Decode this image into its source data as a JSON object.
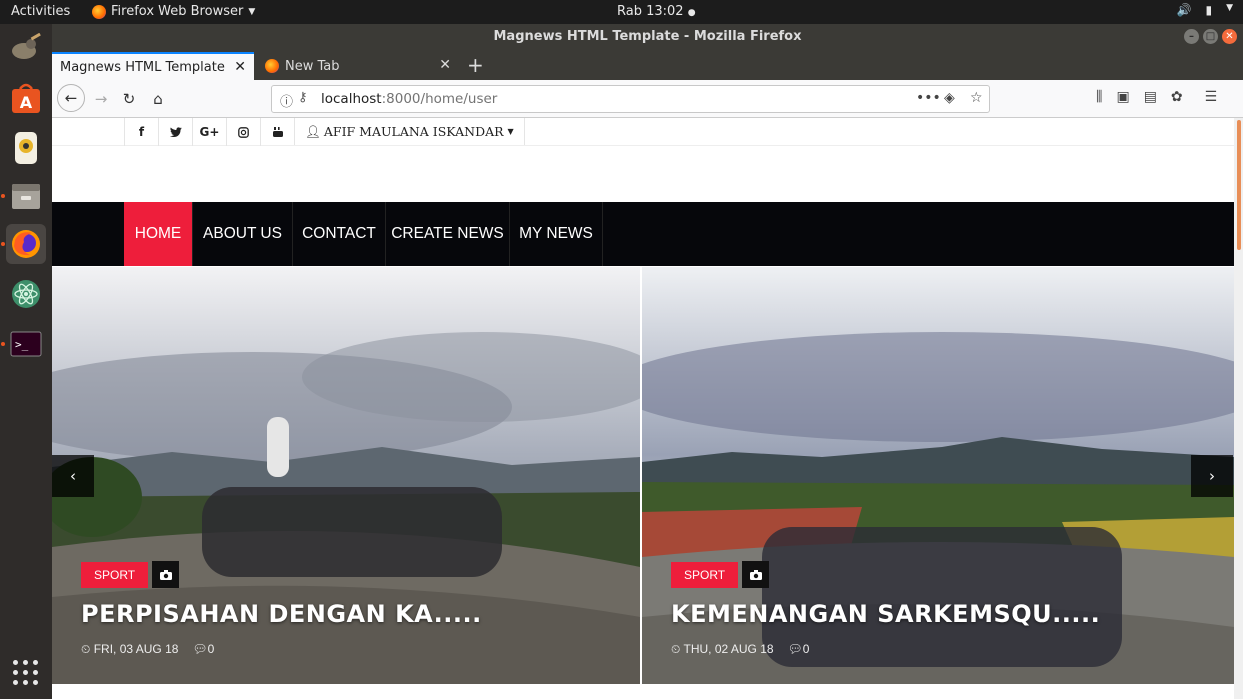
{
  "desktop": {
    "activities": "Activities",
    "app_menu": "Firefox Web Browser",
    "clock": "Rab 13:02"
  },
  "window": {
    "title": "Magnews HTML Template - Mozilla Firefox"
  },
  "tabs": [
    {
      "label": "Magnews HTML Template"
    },
    {
      "label": "New Tab"
    }
  ],
  "url": {
    "host": "localhost",
    "path": ":8000/home/user"
  },
  "site": {
    "social_icons": [
      "f",
      "t",
      "G+",
      "ig",
      "yt"
    ],
    "user_menu": "AFIF MAULANA ISKANDAR",
    "menu": [
      {
        "label": "HOME"
      },
      {
        "label": "ABOUT US"
      },
      {
        "label": "CONTACT"
      },
      {
        "label": "CREATE NEWS"
      },
      {
        "label": "MY NEWS"
      }
    ],
    "slides": [
      {
        "category": "SPORT",
        "title": "PERPISAHAN DENGAN KA.....",
        "date": "FRI, 03 AUG 18",
        "comments": "0"
      },
      {
        "category": "SPORT",
        "title": "KEMENANGAN SARKEMSQU.....",
        "date": "THU, 02 AUG 18",
        "comments": "0"
      }
    ]
  },
  "colors": {
    "accent": "#ee1e3b",
    "menu_bg": "#06070b"
  }
}
